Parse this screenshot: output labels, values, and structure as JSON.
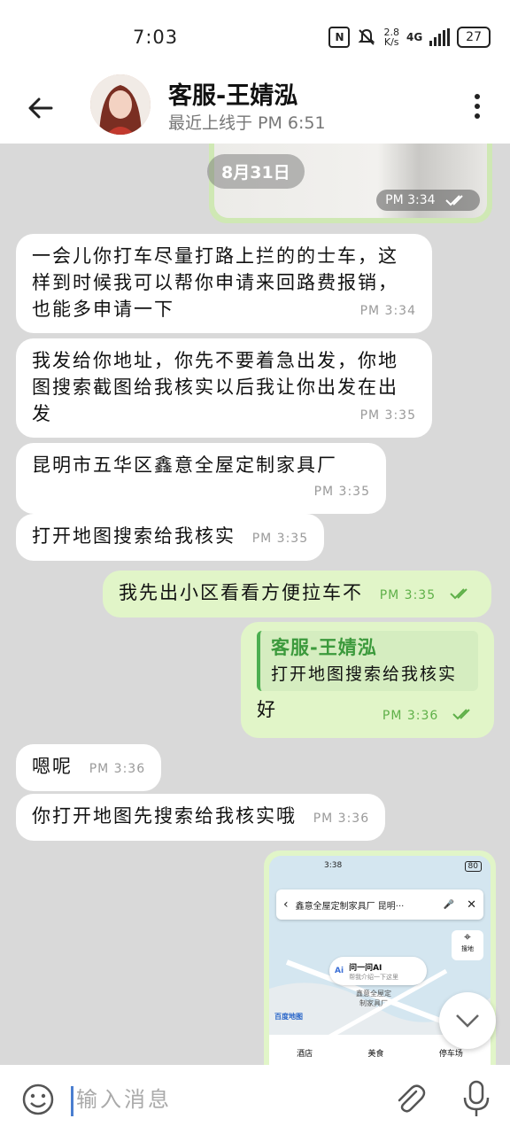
{
  "status_bar": {
    "time": "7:03",
    "speed_value": "2.8",
    "speed_unit": "K/s",
    "network": "4G",
    "battery": "27"
  },
  "header": {
    "contact_name": "客服-王婧泓",
    "last_seen": "最近上线于 PM 6:51"
  },
  "chat": {
    "top_media_time": "PM 3:34",
    "date_chip": "8月31日",
    "messages": [
      {
        "dir": "in",
        "text": "一会儿你打车尽量打路上拦的的士车，这样到时候我可以帮你申请来回路费报销，也能多申请一下",
        "time": "PM 3:34"
      },
      {
        "dir": "in",
        "text": "我发给你地址，你先不要着急出发，你地图搜索截图给我核实以后我让你出发在出发",
        "time": "PM 3:35"
      },
      {
        "dir": "in",
        "text": "昆明市五华区鑫意全屋定制家具厂",
        "time": "PM 3:35"
      },
      {
        "dir": "in",
        "text": "打开地图搜索给我核实",
        "time": "PM 3:35"
      },
      {
        "dir": "out",
        "text": "我先出小区看看方便拉车不",
        "time": "PM 3:35"
      },
      {
        "dir": "out",
        "quote_name": "客服-王婧泓",
        "quote_text": "打开地图搜索给我核实",
        "text": "好",
        "time": "PM 3:36"
      },
      {
        "dir": "in",
        "text": "嗯呢",
        "time": "PM 3:36"
      },
      {
        "dir": "in",
        "text": "你打开地图先搜索给我核实哦",
        "time": "PM 3:36"
      }
    ],
    "screenshot": {
      "status_time": "3:38",
      "status_battery": "80",
      "search_text": "鑫意全屋定制家具厂 昆明···",
      "location_label": "搜地",
      "ai_label": "问一问AI",
      "ai_sub": "帮我介绍一下这里",
      "map_place": "鑫意全屋定\n制家具厂",
      "map_brand": "百度地图",
      "bottom_items": [
        "酒店",
        "美食",
        "停车场"
      ]
    }
  },
  "input_bar": {
    "placeholder": "输入消息"
  },
  "colors": {
    "chat_bg": "#d9d9d9",
    "outgoing_bubble": "#e1f5c8",
    "incoming_bubble": "#ffffff",
    "outgoing_time": "#5fb049",
    "quote_accent": "#4caf50"
  }
}
